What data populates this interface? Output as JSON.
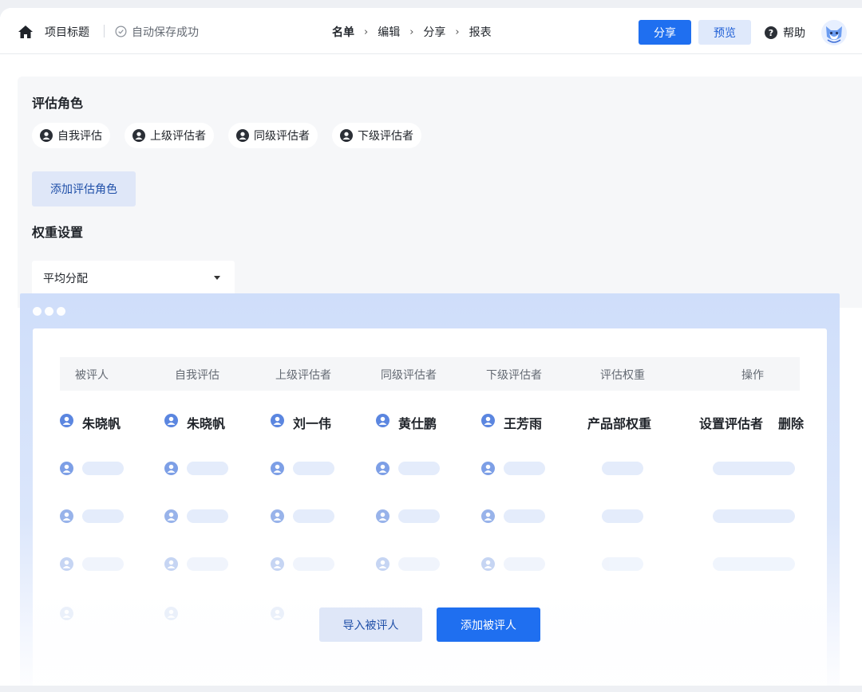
{
  "header": {
    "project_title": "项目标题",
    "save_status": "自动保存成功",
    "breadcrumbs": [
      {
        "label": "名单",
        "active": true
      },
      {
        "label": "编辑",
        "active": false
      },
      {
        "label": "分享",
        "active": false
      },
      {
        "label": "报表",
        "active": false
      }
    ],
    "share_label": "分享",
    "preview_label": "预览",
    "help_label": "帮助"
  },
  "roles_section": {
    "title": "评估角色",
    "roles": [
      "自我评估",
      "上级评估者",
      "同级评估者",
      "下级评估者"
    ],
    "add_role_label": "添加评估角色"
  },
  "weight_section": {
    "title": "权重设置",
    "selected_option": "平均分配"
  },
  "table": {
    "columns": [
      "被评人",
      "自我评估",
      "上级评估者",
      "同级评估者",
      "下级评估者",
      "评估权重",
      "操作"
    ],
    "first_row": {
      "evaluatee": "朱晓帆",
      "self": "朱晓帆",
      "superior": "刘一伟",
      "peer": "黄仕鹏",
      "subordinate": "王芳雨",
      "weight": "产品部权重",
      "actions": [
        "设置评估者",
        "删除"
      ]
    }
  },
  "footer": {
    "import_label": "导入被评人",
    "add_label": "添加被评人"
  },
  "colors": {
    "primary": "#1f6ff0",
    "secondary_bg": "#dfe7f8",
    "person_icon": "#5b86e0"
  },
  "icons": [
    "home-icon",
    "check-circle-icon",
    "chevron-right-icon",
    "help-icon",
    "user-icon",
    "caret-down-icon"
  ]
}
